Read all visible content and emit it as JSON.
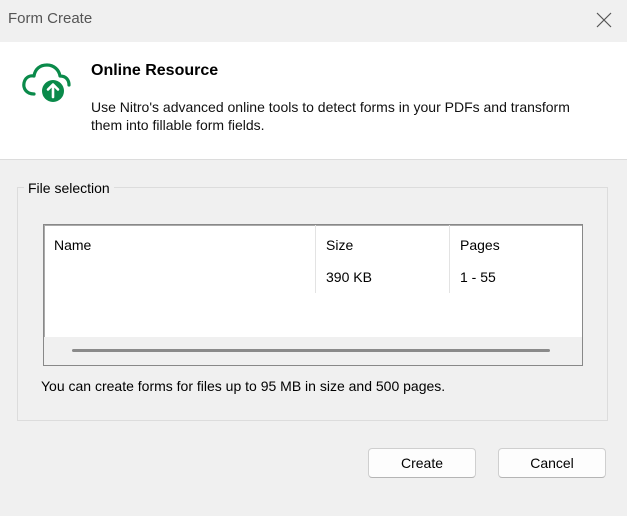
{
  "window": {
    "title": "Form Create"
  },
  "header": {
    "title": "Online Resource",
    "description": "Use Nitro's advanced online tools to detect forms in your PDFs and transform them into fillable form fields.",
    "icon": "cloud-upload-icon",
    "accent_color": "#0a8a4a"
  },
  "file_selection": {
    "label": "File selection",
    "columns": {
      "name": "Name",
      "size": "Size",
      "pages": "Pages"
    },
    "rows": [
      {
        "name": "",
        "size": "390 KB",
        "pages": "1 - 55"
      }
    ],
    "info": "You can create forms for files up to 95 MB in size and 500 pages."
  },
  "buttons": {
    "create": "Create",
    "cancel": "Cancel"
  }
}
